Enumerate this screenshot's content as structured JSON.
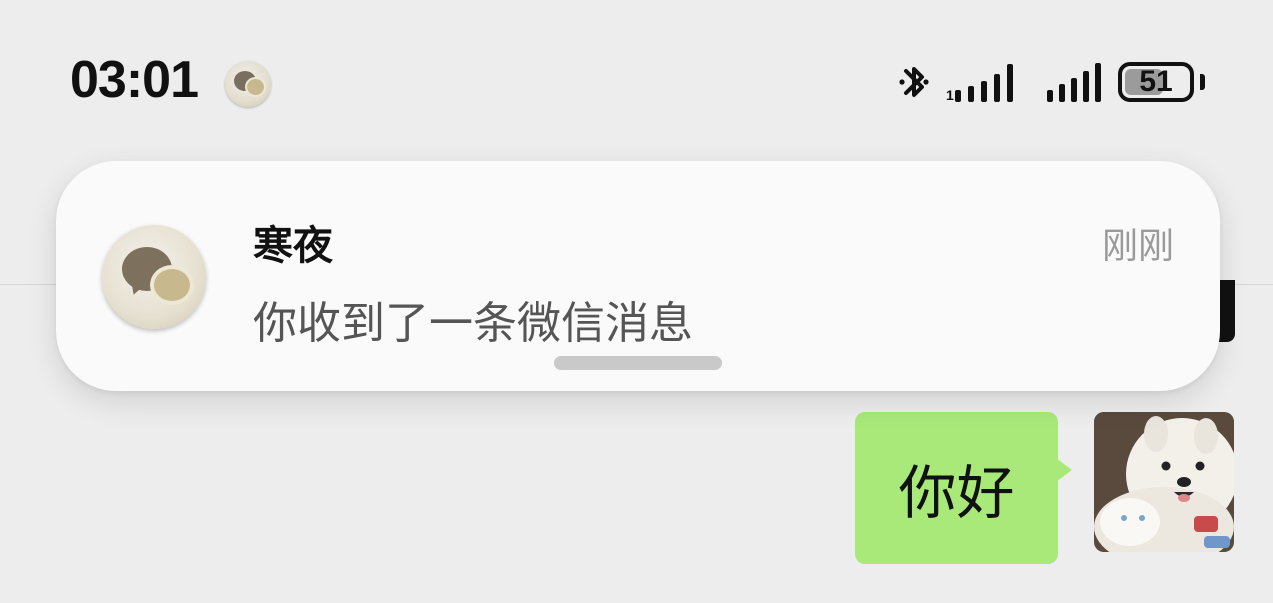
{
  "status_bar": {
    "time": "03:01",
    "battery_percent": "51",
    "icons": [
      "app-notification-icon",
      "bluetooth-icon",
      "signal-icon",
      "signal-icon",
      "battery-icon"
    ]
  },
  "notification": {
    "sender": "寒夜",
    "message": "你收到了一条微信消息",
    "timestamp": "刚刚",
    "app_icon": "wechat-icon"
  },
  "chat": {
    "messages": [
      {
        "direction": "outgoing",
        "text": "你好"
      }
    ]
  },
  "colors": {
    "background": "#ededed",
    "outgoing_bubble": "#a9e97a",
    "notification_bg": "#fafafa"
  }
}
